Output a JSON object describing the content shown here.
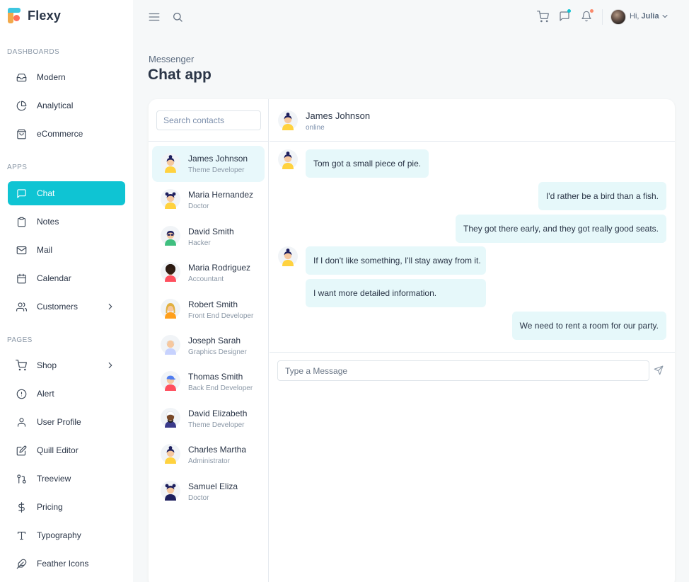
{
  "app": {
    "name": "Flexy"
  },
  "sidebar": {
    "sections": [
      {
        "title": "DASHBOARDS",
        "items": [
          {
            "label": "Modern",
            "icon": "inbox-icon"
          },
          {
            "label": "Analytical",
            "icon": "pie-chart-icon"
          },
          {
            "label": "eCommerce",
            "icon": "shopping-bag-icon"
          }
        ]
      },
      {
        "title": "APPS",
        "items": [
          {
            "label": "Chat",
            "icon": "message-square-icon",
            "active": true
          },
          {
            "label": "Notes",
            "icon": "clipboard-icon"
          },
          {
            "label": "Mail",
            "icon": "mail-icon"
          },
          {
            "label": "Calendar",
            "icon": "calendar-icon"
          },
          {
            "label": "Customers",
            "icon": "users-icon",
            "has_submenu": true
          }
        ]
      },
      {
        "title": "PAGES",
        "items": [
          {
            "label": "Shop",
            "icon": "shopping-cart-icon",
            "has_submenu": true
          },
          {
            "label": "Alert",
            "icon": "alert-circle-icon"
          },
          {
            "label": "User Profile",
            "icon": "user-icon"
          },
          {
            "label": "Quill Editor",
            "icon": "edit-icon"
          },
          {
            "label": "Treeview",
            "icon": "git-pull-request-icon"
          },
          {
            "label": "Pricing",
            "icon": "dollar-sign-icon"
          },
          {
            "label": "Typography",
            "icon": "type-icon"
          },
          {
            "label": "Feather Icons",
            "icon": "feather-icon"
          }
        ]
      }
    ]
  },
  "topbar": {
    "greeting": "Hi,",
    "user_name": "Julia",
    "message_dot_color": "#0fc4d3",
    "bell_dot_color": "#fa896b"
  },
  "page": {
    "breadcrumb": "Messenger",
    "title": "Chat app"
  },
  "contacts": {
    "search_placeholder": "Search contacts",
    "items": [
      {
        "name": "James Johnson",
        "role": "Theme Developer",
        "active": true
      },
      {
        "name": "Maria Hernandez",
        "role": "Doctor"
      },
      {
        "name": "David Smith",
        "role": "Hacker"
      },
      {
        "name": "Maria Rodriguez",
        "role": "Accountant"
      },
      {
        "name": "Robert Smith",
        "role": "Front End Developer"
      },
      {
        "name": "Joseph Sarah",
        "role": "Graphics Designer"
      },
      {
        "name": "Thomas Smith",
        "role": "Back End Developer"
      },
      {
        "name": "David Elizabeth",
        "role": "Theme Developer"
      },
      {
        "name": "Charles Martha",
        "role": "Administrator"
      },
      {
        "name": "Samuel Eliza",
        "role": "Doctor"
      }
    ]
  },
  "chat": {
    "contact_name": "James Johnson",
    "contact_status": "online",
    "messages": [
      {
        "text": "Tom got a small piece of pie.",
        "from": "them"
      },
      {
        "text": "I'd rather be a bird than a fish.",
        "from": "me"
      },
      {
        "text": "They got there early, and they got really good seats.",
        "from": "me"
      },
      {
        "text": "If I don't like something, I'll stay away from it.",
        "from": "them"
      },
      {
        "text": "I want more detailed information.",
        "from": "them"
      },
      {
        "text": "We need to rent a room for our party.",
        "from": "me"
      }
    ],
    "input_placeholder": "Type a Message"
  },
  "colors": {
    "accent": "#0fc4d3",
    "bubble_bg": "#e6f8fa",
    "active_contact_bg": "#e8f8fb"
  }
}
